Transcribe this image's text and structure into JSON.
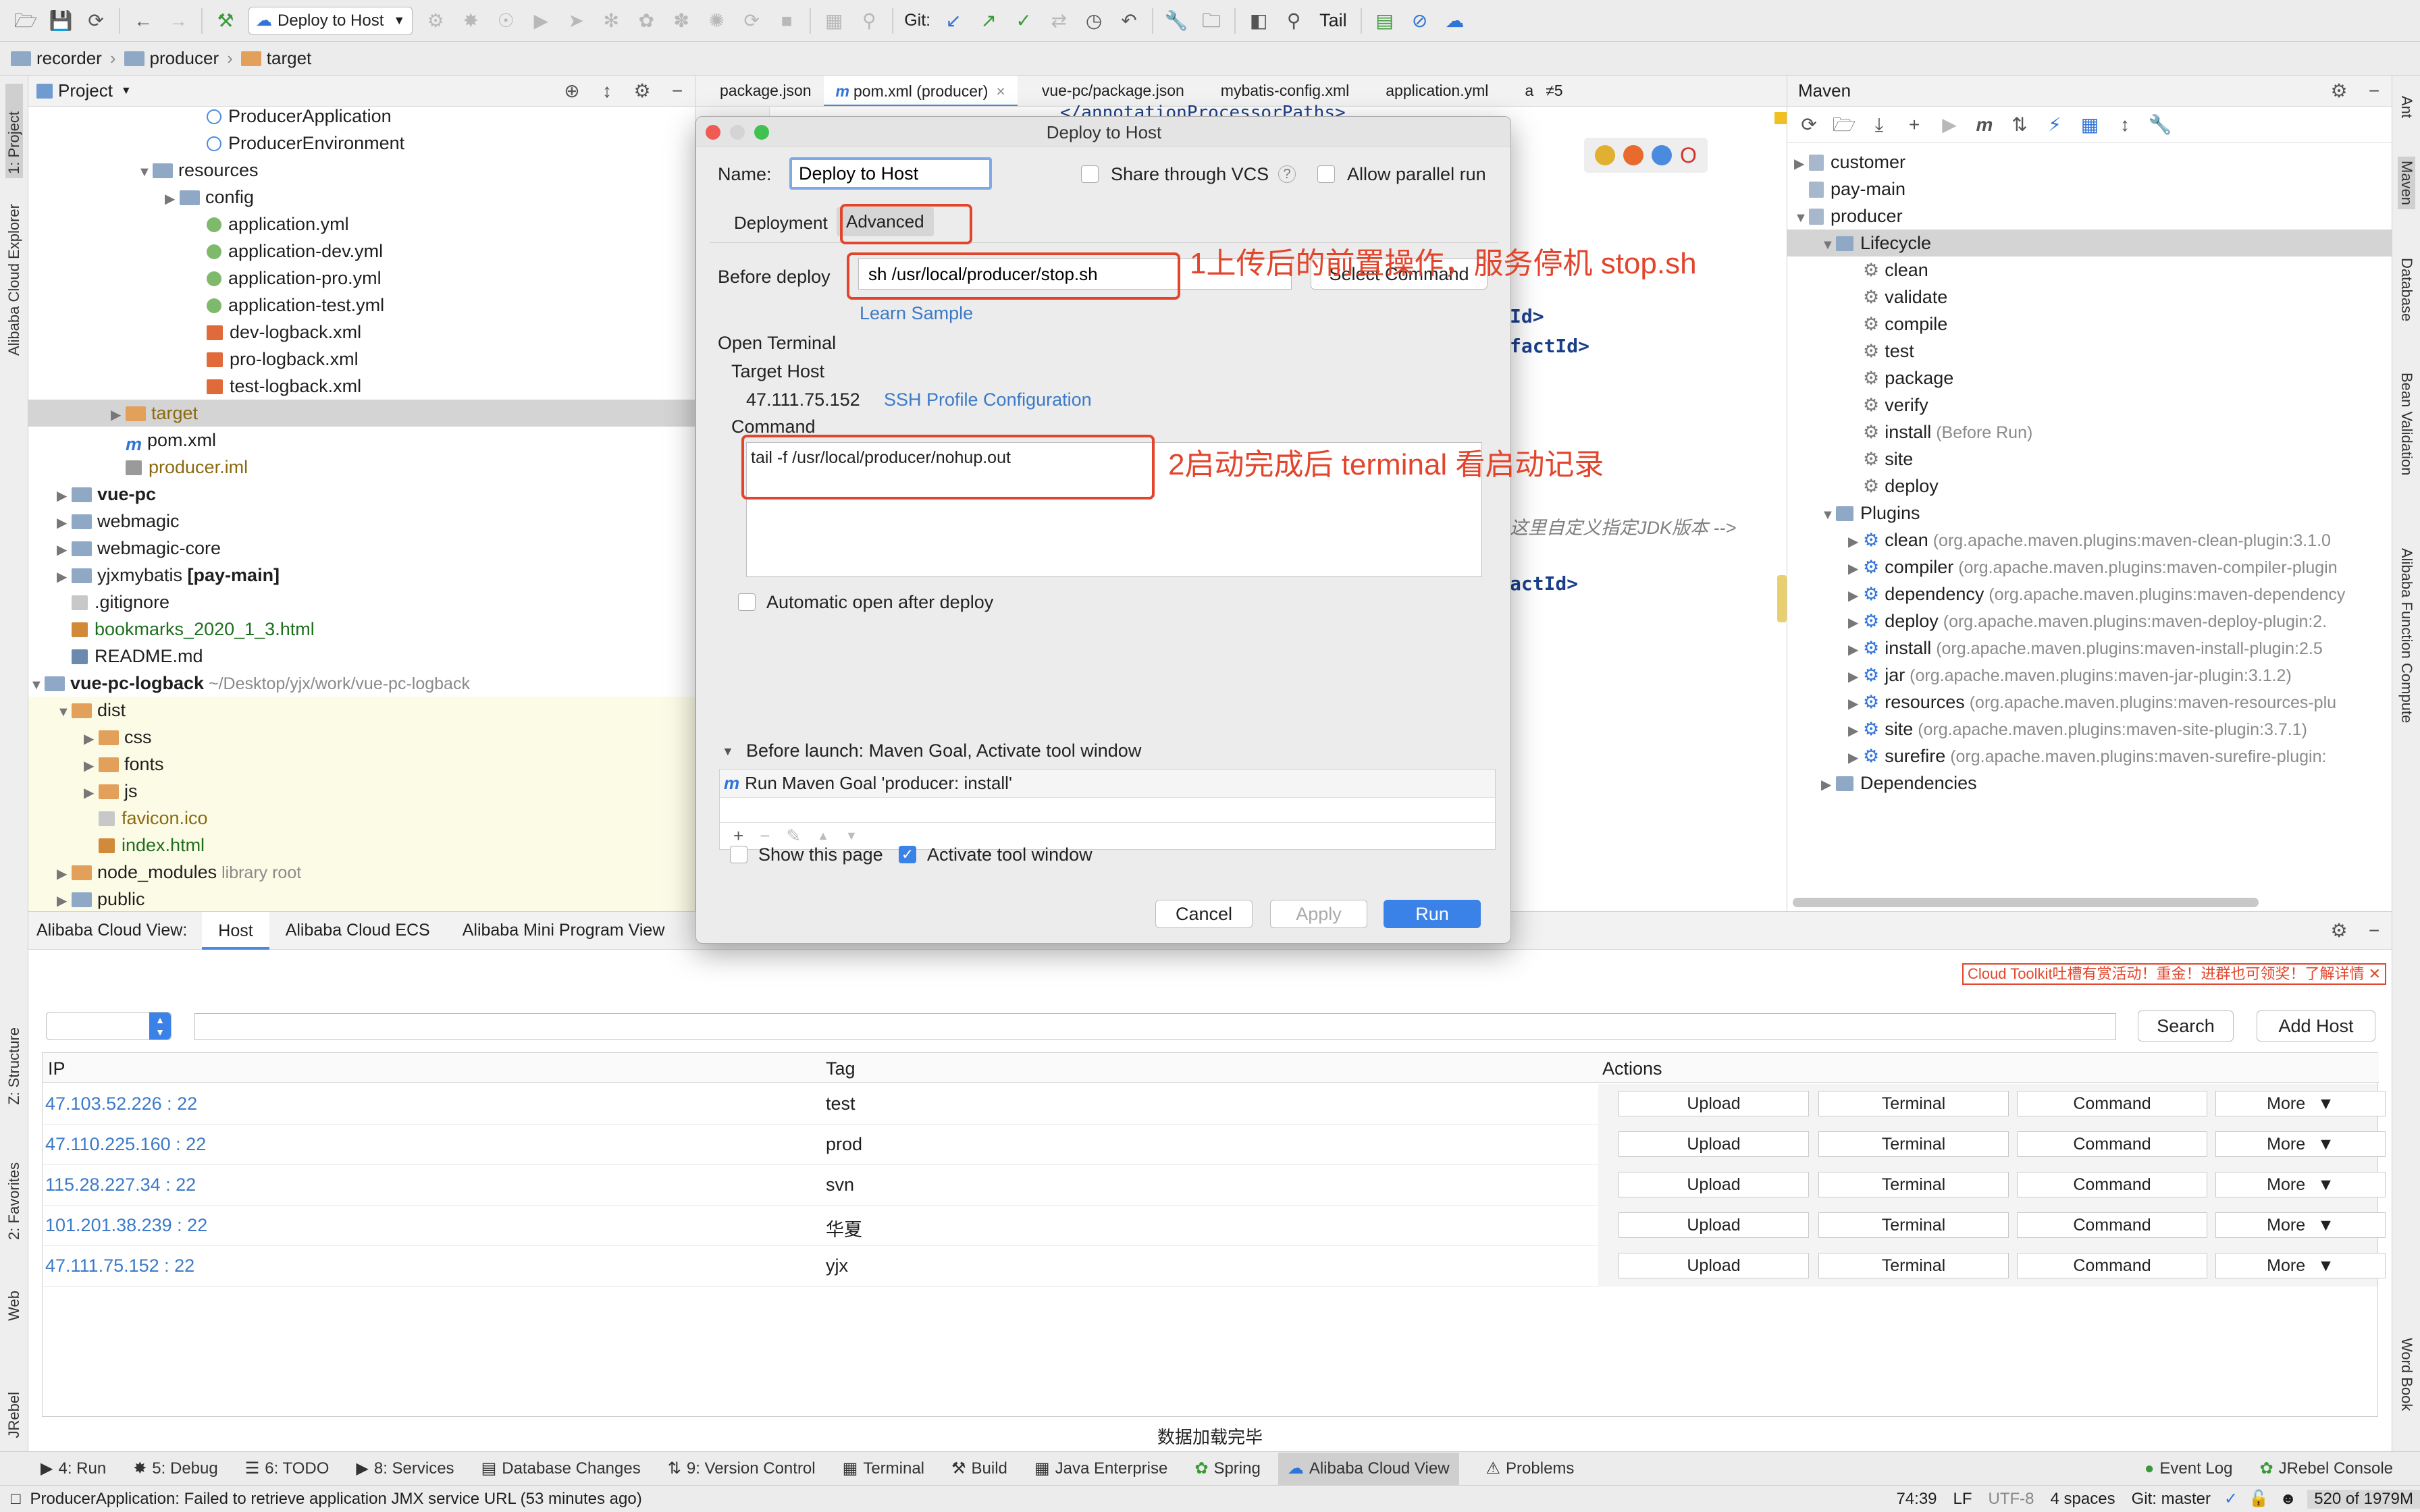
{
  "toolbar": {
    "run_config": "Deploy to Host",
    "git_label": "Git:",
    "tail_label": "Tail"
  },
  "breadcrumb": [
    "recorder",
    "producer",
    "target"
  ],
  "left_strip": {
    "project": "1: Project",
    "cloud_explorer": "Alibaba Cloud Explorer",
    "structure": "Z: Structure",
    "favorites": "2: Favorites",
    "web": "Web",
    "jrebel": "JRebel"
  },
  "right_strip": {
    "ant": "Ant",
    "maven": "Maven",
    "database": "Database",
    "bean_validation": "Bean Validation",
    "function_compute": "Alibaba Function Compute",
    "word_book": "Word Book"
  },
  "project_panel": {
    "title": "Project",
    "tree": [
      {
        "label": "ProducerApplication",
        "suffix": "",
        "icon": "class"
      },
      {
        "label": "ProducerEnvironment",
        "suffix": "",
        "icon": "class"
      },
      {
        "label": "resources",
        "suffix": "",
        "icon": "folder"
      },
      {
        "label": "config",
        "suffix": "",
        "icon": "folder"
      },
      {
        "label": "application.yml",
        "suffix": "",
        "icon": "yml"
      },
      {
        "label": "application-dev.yml",
        "suffix": "",
        "icon": "yml"
      },
      {
        "label": "application-pro.yml",
        "suffix": "",
        "icon": "yml"
      },
      {
        "label": "application-test.yml",
        "suffix": "",
        "icon": "yml"
      },
      {
        "label": "dev-logback.xml",
        "suffix": "",
        "icon": "xml"
      },
      {
        "label": "pro-logback.xml",
        "suffix": "",
        "icon": "xml"
      },
      {
        "label": "test-logback.xml",
        "suffix": "",
        "icon": "xml"
      },
      {
        "label": "target",
        "suffix": "",
        "icon": "folder-orange"
      },
      {
        "label": "pom.xml",
        "suffix": "",
        "icon": "maven"
      },
      {
        "label": "producer.iml",
        "suffix": "",
        "icon": "iml"
      },
      {
        "label": "vue-pc",
        "suffix": "",
        "icon": "folder"
      },
      {
        "label": "webmagic",
        "suffix": "",
        "icon": "folder"
      },
      {
        "label": "webmagic-core",
        "suffix": "",
        "icon": "folder"
      },
      {
        "label": "yjxmybatis",
        "suffix": "[pay-main]",
        "icon": "folder"
      },
      {
        "label": ".gitignore",
        "suffix": "",
        "icon": "file"
      },
      {
        "label": "bookmarks_2020_1_3.html",
        "suffix": "",
        "icon": "html"
      },
      {
        "label": "README.md",
        "suffix": "",
        "icon": "md"
      },
      {
        "label": "vue-pc-logback",
        "suffix": "~/Desktop/yjx/work/vue-pc-logback",
        "icon": "folder"
      },
      {
        "label": "dist",
        "suffix": "",
        "icon": "folder-orange"
      },
      {
        "label": "css",
        "suffix": "",
        "icon": "folder-orange"
      },
      {
        "label": "fonts",
        "suffix": "",
        "icon": "folder-orange"
      },
      {
        "label": "js",
        "suffix": "",
        "icon": "folder-orange"
      },
      {
        "label": "favicon.ico",
        "suffix": "",
        "icon": "file"
      },
      {
        "label": "index.html",
        "suffix": "",
        "icon": "html"
      },
      {
        "label": "node_modules",
        "suffix": "library root",
        "icon": "folder-orange"
      },
      {
        "label": "public",
        "suffix": "",
        "icon": "folder"
      }
    ]
  },
  "editor": {
    "tabs": [
      "package.json",
      "pom.xml (producer)",
      "vue-pc/package.json",
      "mybatis-config.xml",
      "application.yml",
      "a"
    ],
    "tab_overflow": "≠5",
    "code_lines": [
      "</annotationProcessorPaths>",
      "Id>",
      "factId>",
      "这里自定义指定JDK版本 -->",
      "actId>"
    ]
  },
  "dialog": {
    "title": "Deploy to Host",
    "name_label": "Name:",
    "name_value": "Deploy to Host",
    "share_vcs": "Share through VCS",
    "allow_parallel": "Allow parallel run",
    "tab_deployment": "Deployment",
    "tab_advanced": "Advanced",
    "before_deploy_label": "Before deploy",
    "before_deploy_value": "sh /usr/local/producer/stop.sh",
    "select_command": "Select Command",
    "learn_sample": "Learn Sample",
    "open_terminal": "Open Terminal",
    "target_host_label": "Target Host",
    "target_host_ip": "47.111.75.152",
    "ssh_profile": "SSH Profile Configuration",
    "command_label": "Command",
    "command_value": "tail -f /usr/local/producer/nohup.out",
    "auto_open": "Automatic open after deploy",
    "before_launch": "Before launch: Maven Goal, Activate tool window",
    "maven_goal": "Run Maven Goal 'producer: install'",
    "show_page": "Show this page",
    "activate_window": "Activate tool window",
    "cancel": "Cancel",
    "apply": "Apply",
    "run": "Run"
  },
  "annotations": {
    "note1": "1上传后的前置操作，服务停机 stop.sh",
    "note2": "2启动完成后 terminal 看启动记录"
  },
  "maven_panel": {
    "title": "Maven",
    "tree": [
      {
        "label": "customer",
        "detail": ""
      },
      {
        "label": "pay-main",
        "detail": ""
      },
      {
        "label": "producer",
        "detail": ""
      },
      {
        "label": "Lifecycle",
        "detail": ""
      },
      {
        "label": "clean",
        "detail": ""
      },
      {
        "label": "validate",
        "detail": ""
      },
      {
        "label": "compile",
        "detail": ""
      },
      {
        "label": "test",
        "detail": ""
      },
      {
        "label": "package",
        "detail": ""
      },
      {
        "label": "verify",
        "detail": ""
      },
      {
        "label": "install",
        "detail": "(Before Run)"
      },
      {
        "label": "site",
        "detail": ""
      },
      {
        "label": "deploy",
        "detail": ""
      },
      {
        "label": "Plugins",
        "detail": ""
      },
      {
        "label": "clean",
        "detail": "(org.apache.maven.plugins:maven-clean-plugin:3.1.0"
      },
      {
        "label": "compiler",
        "detail": "(org.apache.maven.plugins:maven-compiler-plugin"
      },
      {
        "label": "dependency",
        "detail": "(org.apache.maven.plugins:maven-dependency"
      },
      {
        "label": "deploy",
        "detail": "(org.apache.maven.plugins:maven-deploy-plugin:2."
      },
      {
        "label": "install",
        "detail": "(org.apache.maven.plugins:maven-install-plugin:2.5"
      },
      {
        "label": "jar",
        "detail": "(org.apache.maven.plugins:maven-jar-plugin:3.1.2)"
      },
      {
        "label": "resources",
        "detail": "(org.apache.maven.plugins:maven-resources-plu"
      },
      {
        "label": "site",
        "detail": "(org.apache.maven.plugins:maven-site-plugin:3.7.1)"
      },
      {
        "label": "surefire",
        "detail": "(org.apache.maven.plugins:maven-surefire-plugin:"
      },
      {
        "label": "Dependencies",
        "detail": ""
      }
    ]
  },
  "cloud_view": {
    "label": "Alibaba Cloud View:",
    "tabs": [
      "Host",
      "Alibaba Cloud ECS",
      "Alibaba Mini Program View"
    ],
    "promo": "Cloud Toolkit吐槽有赏活动！重金！进群也可领奖！了解详情",
    "search": "Search",
    "add_host": "Add Host",
    "columns": [
      "IP",
      "Tag",
      "Actions"
    ],
    "rows": [
      {
        "ip": "47.103.52.226 : 22",
        "tag": "test"
      },
      {
        "ip": "47.110.225.160 : 22",
        "tag": "prod"
      },
      {
        "ip": "115.28.227.34 : 22",
        "tag": "svn"
      },
      {
        "ip": "101.201.38.239 : 22",
        "tag": "华夏"
      },
      {
        "ip": "47.111.75.152 : 22",
        "tag": "yjx"
      }
    ],
    "actions": [
      "Upload",
      "Terminal",
      "Command",
      "More"
    ],
    "loaded": "数据加载完毕"
  },
  "bottom_tabs": [
    "4: Run",
    "5: Debug",
    "6: TODO",
    "8: Services",
    "Database Changes",
    "9: Version Control",
    "Terminal",
    "Build",
    "Java Enterprise",
    "Spring",
    "Alibaba Cloud View",
    "Problems"
  ],
  "bottom_right_tabs": [
    "Event Log",
    "JRebel Console"
  ],
  "status": {
    "message": "ProducerApplication: Failed to retrieve application JMX service URL (53 minutes ago)",
    "position": "74:39",
    "line_sep": "LF",
    "encoding": "UTF-8",
    "indent": "4 spaces",
    "git": "Git: master",
    "memory": "520 of 1979M"
  },
  "colors": {
    "accent_blue": "#2f74d8",
    "annotation_red": "#e2452c",
    "selection": "#d4d4d4"
  }
}
